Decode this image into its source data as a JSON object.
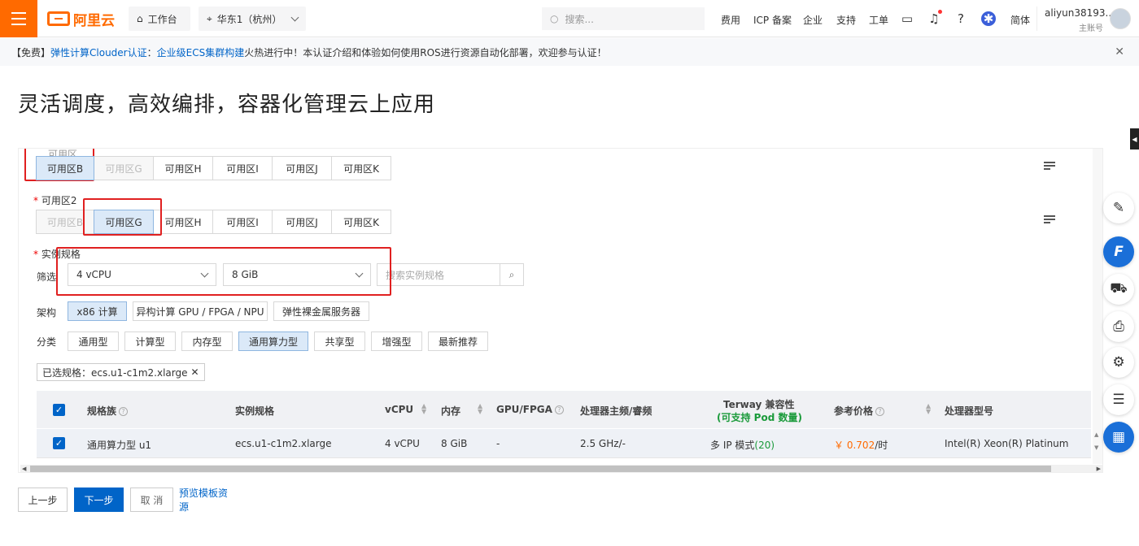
{
  "header": {
    "logo_text": "阿里云",
    "workbench_label": "工作台",
    "region_label": "华东1（杭州）",
    "search_placeholder": "搜索...",
    "nav": [
      "费用",
      "ICP 备案",
      "企业",
      "支持",
      "工单"
    ],
    "lang": "简体",
    "account_name": "aliyun38193...",
    "account_type": "主账号"
  },
  "notice": {
    "prefix": "【免费】",
    "link1": "弹性计算Clouder认证",
    "colon": "：",
    "link2": "企业级ECS集群构建",
    "text": "火热进行中！本认证介绍和体验如何使用ROS进行资源自动化部署，欢迎参与认证！"
  },
  "page_title": "灵活调度，高效编排，容器化管理云上应用",
  "zone1": {
    "label_partial": "可用区",
    "options": [
      "可用区B",
      "可用区G",
      "可用区H",
      "可用区I",
      "可用区J",
      "可用区K"
    ]
  },
  "zone2": {
    "label": "可用区2",
    "options": [
      "可用区B",
      "可用区G",
      "可用区H",
      "可用区I",
      "可用区J",
      "可用区K"
    ]
  },
  "spec": {
    "label": "实例规格",
    "filter_label": "筛选",
    "cpu_value": "4 vCPU",
    "mem_value": "8 GiB",
    "search_placeholder": "搜索实例规格"
  },
  "arch": {
    "label": "架构",
    "options": [
      "x86 计算",
      "异构计算 GPU / FPGA / NPU",
      "弹性裸金属服务器"
    ]
  },
  "category": {
    "label": "分类",
    "options": [
      "通用型",
      "计算型",
      "内存型",
      "通用算力型",
      "共享型",
      "增强型",
      "最新推荐"
    ]
  },
  "selected_tag": "已选规格：ecs.u1-c1m2.xlarge",
  "table": {
    "headers": {
      "family": "规格族",
      "spec": "实例规格",
      "vcpu": "vCPU",
      "mem": "内存",
      "gpu": "GPU/FPGA",
      "freq": "处理器主频/睿频",
      "terway": "Terway 兼容性",
      "terway_sub": "(可支持 Pod 数量)",
      "price": "参考价格",
      "cpu_model": "处理器型号"
    },
    "row": {
      "family": "通用算力型 u1",
      "spec": "ecs.u1-c1m2.xlarge",
      "vcpu": "4 vCPU",
      "mem": "8 GiB",
      "gpu": "-",
      "freq": "2.5 GHz/-",
      "terway_text": "多 IP 模式",
      "terway_num": "(20)",
      "price_symbol": "￥",
      "price_value": "0.702",
      "price_unit": "/时",
      "cpu_model": "Intel(R) Xeon(R) Platinum"
    }
  },
  "footer": {
    "prev": "上一步",
    "next": "下一步",
    "cancel": "取 消",
    "preview": "预览模板资源"
  },
  "colors": {
    "brand": "#ff6a00",
    "link": "#0064c8",
    "selected_bg": "#dbe9f8",
    "highlight_box": "#e02020"
  }
}
